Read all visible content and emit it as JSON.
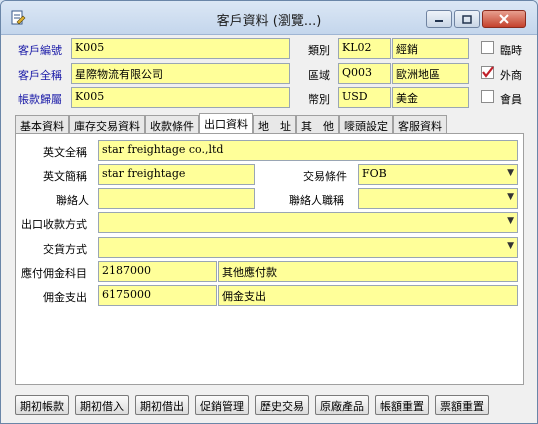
{
  "window": {
    "title": "客戶資料 (瀏覽...)"
  },
  "header": {
    "customer_code_label": "客戶編號",
    "customer_code": "K005",
    "customer_name_label": "客戶全稱",
    "customer_name": "星際物流有限公司",
    "account_owner_label": "帳款歸屬",
    "account_owner": "K005",
    "category_label": "類別",
    "category_code": "KL02",
    "category_name": "經銷",
    "region_label": "區域",
    "region_code": "Q003",
    "region_name": "歐洲地區",
    "currency_label": "幣別",
    "currency_code": "USD",
    "currency_name": "美金",
    "temporary_label": "臨時",
    "temporary_checked": false,
    "foreign_label": "外商",
    "foreign_checked": true,
    "member_label": "會員",
    "member_checked": false
  },
  "tabs": [
    "基本資料",
    "庫存交易資料",
    "收款條件",
    "出口資料",
    "地　址",
    "其　他",
    "嘜頭設定",
    "客服資料"
  ],
  "active_tab": 3,
  "export": {
    "english_name_label": "英文全稱",
    "english_name": "star freightage co.,ltd",
    "english_short_label": "英文簡稱",
    "english_short": "star freightage",
    "trade_terms_label": "交易條件",
    "trade_terms": "FOB",
    "contact_label": "聯絡人",
    "contact": "",
    "contact_title_label": "聯絡人職稱",
    "contact_title": "",
    "export_payment_label": "出口收款方式",
    "export_payment": "",
    "delivery_label": "交貨方式",
    "delivery": "",
    "commission_payable_label": "應付佣金科目",
    "commission_payable_code": "2187000",
    "commission_payable_name": "其他應付款",
    "commission_paid_label": "佣金支出",
    "commission_paid_code": "6175000",
    "commission_paid_name": "佣金支出"
  },
  "buttons": [
    "期初帳款",
    "期初借入",
    "期初借出",
    "促銷管理",
    "歷史交易",
    "原廠產品",
    "帳額重置",
    "票額重置"
  ]
}
